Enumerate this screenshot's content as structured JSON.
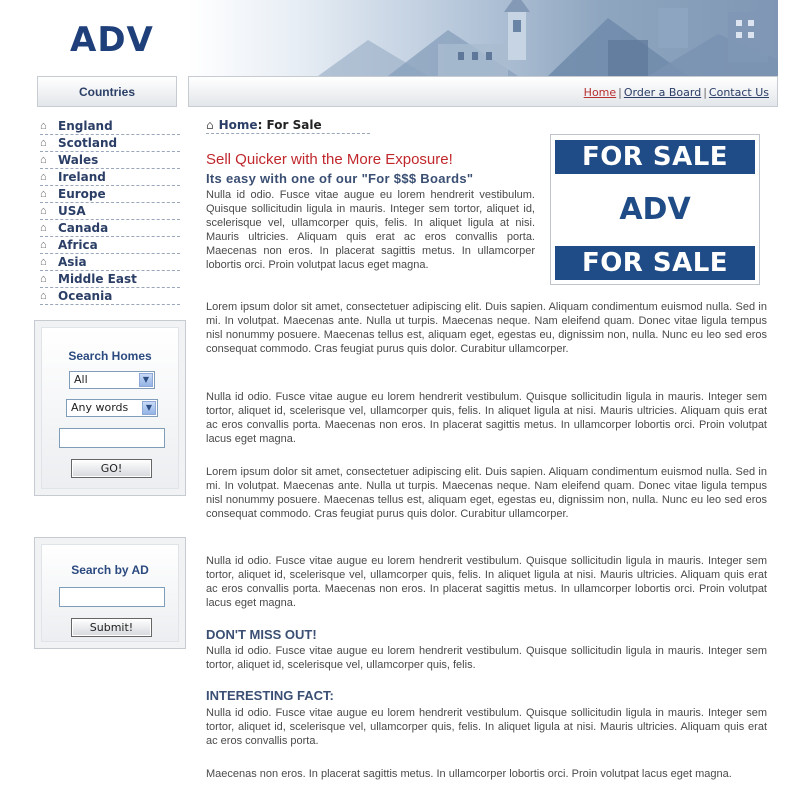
{
  "logo": "ADV",
  "sidebar": {
    "title": "Countries",
    "countries": [
      "England",
      "Scotland",
      "Wales",
      "Ireland",
      "Europe",
      "USA",
      "Canada",
      "Africa",
      "Asia",
      "Middle East",
      "Oceania"
    ]
  },
  "topnav": {
    "links": [
      "Home",
      "Order a Board",
      "Contact Us"
    ],
    "separator": "|"
  },
  "search_homes": {
    "title": "Search Homes",
    "select1_value": "All",
    "select2_value": "Any words",
    "input_value": "",
    "button": "GO!"
  },
  "search_ad": {
    "title": "Search by AD",
    "input_value": "",
    "button": "Submit!"
  },
  "breadcrumb": {
    "home": "Home",
    "current": ": For Sale"
  },
  "promo_image": {
    "top": "FOR SALE",
    "middle": "ADV",
    "bottom": "FOR SALE"
  },
  "content": {
    "headline": "Sell Quicker with the More Exposure!",
    "subhead": "Its easy with one of our \"For $$$ Boards\"",
    "p1": "Nulla id odio. Fusce vitae augue eu lorem hendrerit vestibulum. Quisque sollicitudin ligula in mauris. Integer sem tortor, aliquet id, scelerisque vel, ullamcorper quis, felis. In aliquet ligula at nisi. Mauris ultricies. Aliquam quis erat ac eros convallis porta. Maecenas non eros. In placerat sagittis metus. In ullamcorper lobortis orci. Proin volutpat lacus eget magna.",
    "p2": "Lorem ipsum dolor sit amet, consectetuer adipiscing elit. Duis sapien. Aliquam condimentum euismod nulla. Sed in mi. In volutpat. Maecenas ante. Nulla ut turpis. Maecenas neque. Nam eleifend quam. Donec vitae ligula tempus nisl nonummy posuere. Maecenas tellus est, aliquam eget, egestas eu, dignissim non, nulla. Nunc eu leo sed eros consequat commodo. Cras feugiat purus quis dolor. Curabitur ullamcorper.",
    "p3": "Nulla id odio. Fusce vitae augue eu lorem hendrerit vestibulum. Quisque sollicitudin ligula in mauris. Integer sem tortor, aliquet id, scelerisque vel, ullamcorper quis, felis. In aliquet ligula at nisi. Mauris ultricies. Aliquam quis erat ac eros convallis porta. Maecenas non eros. In placerat sagittis metus. In ullamcorper lobortis orci. Proin volutpat lacus eget magna.",
    "p4": "Lorem ipsum dolor sit amet, consectetuer adipiscing elit. Duis sapien. Aliquam condimentum euismod nulla. Sed in mi. In volutpat. Maecenas ante. Nulla ut turpis. Maecenas neque. Nam eleifend quam. Donec vitae ligula tempus nisl nonummy posuere. Maecenas tellus est, aliquam eget, egestas eu, dignissim non, nulla. Nunc eu leo sed eros consequat commodo. Cras feugiat purus quis dolor. Curabitur ullamcorper.",
    "p5": "Nulla id odio. Fusce vitae augue eu lorem hendrerit vestibulum. Quisque sollicitudin ligula in mauris. Integer sem tortor, aliquet id, scelerisque vel, ullamcorper quis, felis. In aliquet ligula at nisi. Mauris ultricies. Aliquam quis erat ac eros convallis porta. Maecenas non eros. In placerat sagittis metus. In ullamcorper lobortis orci. Proin volutpat lacus eget magna.",
    "section1_title": "DON'T MISS OUT!",
    "section1_text": "Nulla id odio. Fusce vitae augue eu lorem hendrerit vestibulum. Quisque sollicitudin ligula in mauris. Integer sem tortor, aliquet id, scelerisque vel, ullamcorper quis, felis.",
    "section2_title": "INTERESTING FACT:",
    "section2_text": "Nulla id odio. Fusce vitae augue eu lorem hendrerit vestibulum. Quisque sollicitudin ligula in mauris. Integer sem tortor, aliquet id, scelerisque vel, ullamcorper quis, felis. In aliquet ligula at nisi. Mauris ultricies. Aliquam quis erat ac eros convallis porta.",
    "p_last": "Maecenas non eros. In placerat sagittis metus. In ullamcorper lobortis orci. Proin volutpat lacus eget magna."
  },
  "colors": {
    "brand": "#1e3f7a",
    "headline": "#c0282d",
    "link": "#2b3e66",
    "active_link": "#b83030",
    "sign_blue": "#1f4c86"
  },
  "icons": {
    "country_item": "home-icon",
    "breadcrumb": "home-icon",
    "select_arrow": "chevron-down-icon"
  }
}
